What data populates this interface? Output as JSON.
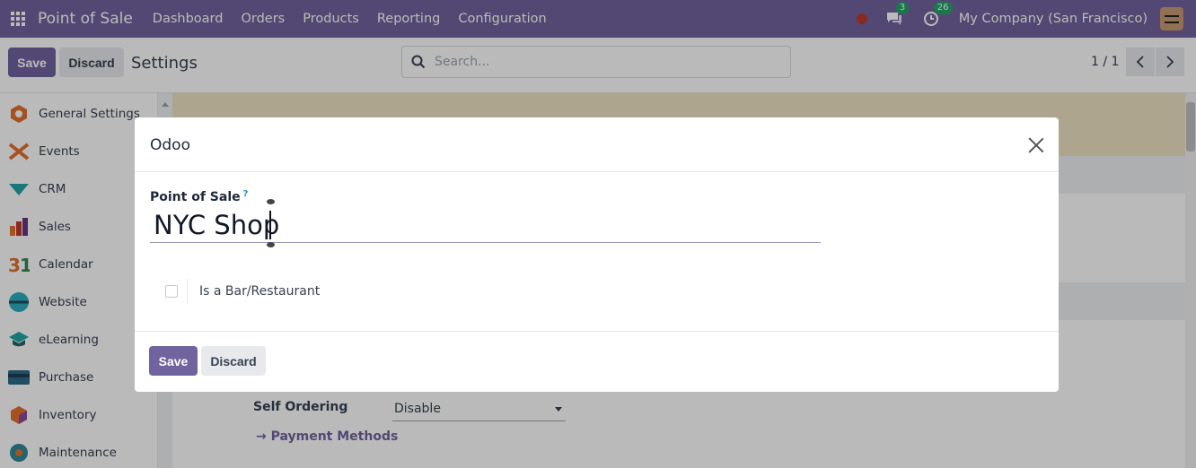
{
  "topnav": {
    "brand": "Point of Sale",
    "menu": [
      "Dashboard",
      "Orders",
      "Products",
      "Reporting",
      "Configuration"
    ],
    "chat_count": "3",
    "activity_count": "26",
    "company": "My Company (San Francisco)"
  },
  "control_panel": {
    "save_label": "Save",
    "discard_label": "Discard",
    "title": "Settings",
    "search_placeholder": "Search...",
    "pager": "1 / 1"
  },
  "sidebar": {
    "items": [
      {
        "label": "General Settings",
        "icon": "general-settings-icon",
        "color": "#e46f2d"
      },
      {
        "label": "Events",
        "icon": "events-icon",
        "color": "#e46f2d"
      },
      {
        "label": "CRM",
        "icon": "crm-icon",
        "color": "#22a5a5"
      },
      {
        "label": "Sales",
        "icon": "sales-icon",
        "color": "#e46f2d"
      },
      {
        "label": "Calendar",
        "icon": "calendar-icon",
        "color": "#2f8a55"
      },
      {
        "label": "Website",
        "icon": "website-icon",
        "color": "#2bafc0"
      },
      {
        "label": "eLearning",
        "icon": "elearning-icon",
        "color": "#22a5a5"
      },
      {
        "label": "Purchase",
        "icon": "purchase-icon",
        "color": "#2f6b8a"
      },
      {
        "label": "Inventory",
        "icon": "inventory-icon",
        "color": "#e46f2d"
      },
      {
        "label": "Maintenance",
        "icon": "maintenance-icon",
        "color": "#2f8a9a"
      }
    ]
  },
  "background_form": {
    "self_ordering_label": "Self Ordering",
    "self_ordering_value": "Disable",
    "payment_methods_link": "Payment Methods"
  },
  "modal": {
    "title": "Odoo",
    "field_label": "Point of Sale",
    "help_mark": "?",
    "name_value": "NYC Shop",
    "checkbox_label": "Is a Bar/Restaurant",
    "checkbox_checked": false,
    "save_label": "Save",
    "discard_label": "Discard"
  },
  "colors": {
    "brand": "#71639e",
    "warning_band": "#efe3c3",
    "badge": "#21a564"
  }
}
